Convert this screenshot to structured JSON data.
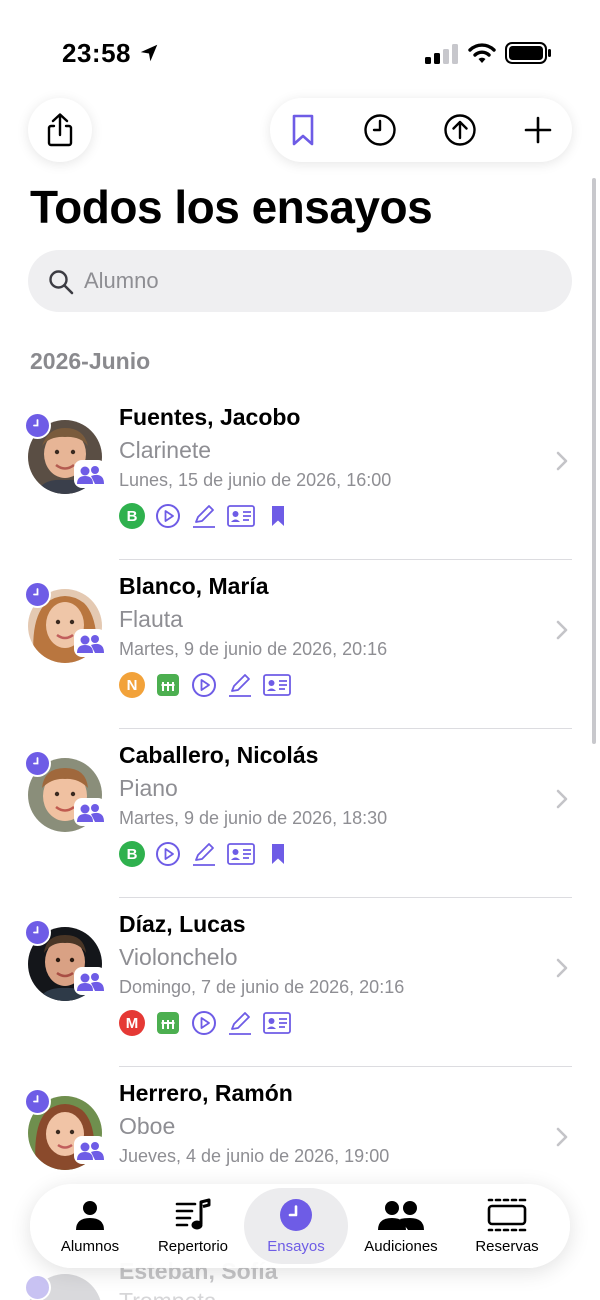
{
  "status_bar": {
    "time": "23:58"
  },
  "page": {
    "title": "Todos los ensayos"
  },
  "search": {
    "placeholder": "Alumno"
  },
  "section": {
    "header": "2026-Junio"
  },
  "colors": {
    "accent": "#6e5ce6",
    "badge_green": "#2fb14e",
    "badge_orange": "#f2a23a",
    "badge_red": "#e53935",
    "icon_green": "#4caf50"
  },
  "rows": [
    {
      "name": "Fuentes, Jacobo",
      "instrument": "Clarinete",
      "date": "Lunes, 15 de junio de 2026, 16:00",
      "badge_letter": "B"
    },
    {
      "name": "Blanco, María",
      "instrument": "Flauta",
      "date": "Martes, 9 de junio de 2026, 20:16",
      "badge_letter": "N"
    },
    {
      "name": "Caballero, Nicolás",
      "instrument": "Piano",
      "date": "Martes, 9 de junio de 2026, 18:30",
      "badge_letter": "B"
    },
    {
      "name": "Díaz, Lucas",
      "instrument": "Violonchelo",
      "date": "Domingo, 7 de junio de 2026, 20:16",
      "badge_letter": "M"
    },
    {
      "name": "Herrero, Ramón",
      "instrument": "Oboe",
      "date": "Jueves, 4 de junio de 2026, 19:00"
    }
  ],
  "peek_row": {
    "name": "Esteban, Sofía",
    "instrument": "Trompeta"
  },
  "tabs": [
    {
      "label": "Alumnos",
      "icon": "person-icon"
    },
    {
      "label": "Repertorio",
      "icon": "music-list-icon"
    },
    {
      "label": "Ensayos",
      "icon": "clock-icon",
      "active": true
    },
    {
      "label": "Audiciones",
      "icon": "people-icon"
    },
    {
      "label": "Reservas",
      "icon": "reservations-icon"
    }
  ]
}
